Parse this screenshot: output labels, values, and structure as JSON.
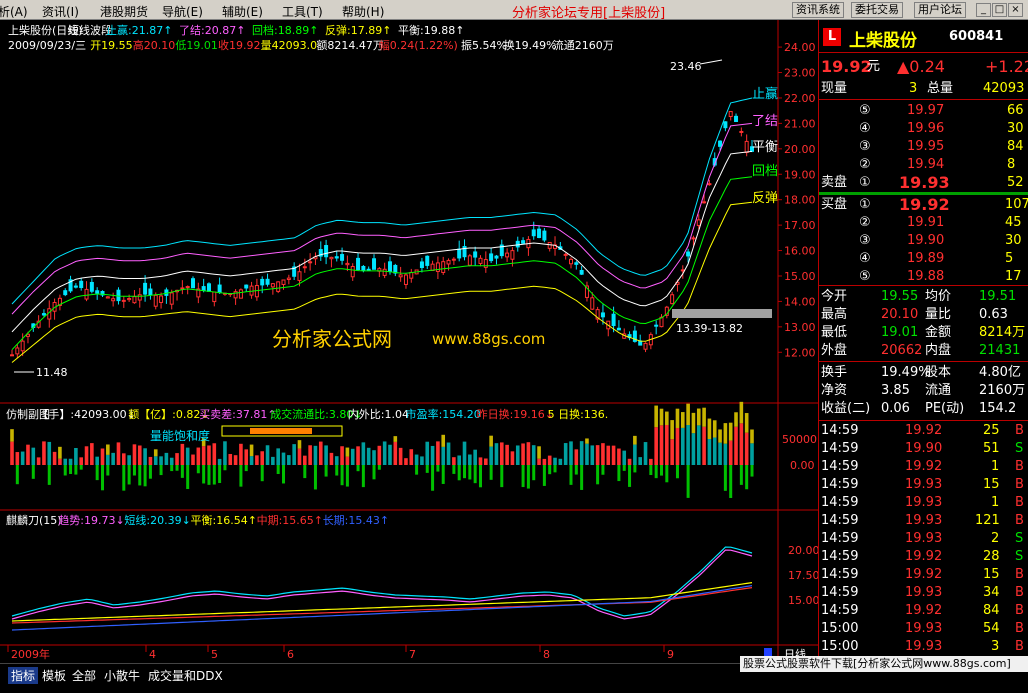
{
  "menubar": {
    "items": [
      "析(A)",
      "资讯(I)",
      "港股期货",
      "导航(E)",
      "辅助(E)",
      "工具(T)",
      "帮助(H)"
    ],
    "title": "分析家论坛专用[上柴股份]",
    "buttons": [
      "资讯系统",
      "委托交易",
      "用户论坛"
    ],
    "window_controls": [
      "_",
      "□",
      "×"
    ]
  },
  "main_chart": {
    "legend_line1": [
      {
        "text": "上柴股份(日线)",
        "color": "#ffffff"
      },
      {
        "text": "短线波段",
        "color": "#ffffff"
      },
      {
        "text": "止赢:21.87↑",
        "color": "#00e5ff"
      },
      {
        "text": "了结:20.87↑",
        "color": "#ff60ff"
      },
      {
        "text": "回档:18.89↑",
        "color": "#00ff00"
      },
      {
        "text": "反弹:17.89↑",
        "color": "#ffff00"
      },
      {
        "text": "平衡:19.88↑",
        "color": "#ffffff"
      }
    ],
    "legend_line2": [
      {
        "text": "2009/09/23/三",
        "color": "#ffffff"
      },
      {
        "text": "开19.55",
        "color": "#ffff00"
      },
      {
        "text": "高20.10",
        "color": "#ff3030"
      },
      {
        "text": "低19.01",
        "color": "#00e000"
      },
      {
        "text": "收19.92",
        "color": "#ff3030"
      },
      {
        "text": "量42093.0",
        "color": "#ffff00"
      },
      {
        "text": "额8214.47万",
        "color": "#ffffff"
      },
      {
        "text": "幅0.24(1.22%)",
        "color": "#ff3030"
      },
      {
        "text": "振5.54%",
        "color": "#ffffff"
      },
      {
        "text": "换19.49%",
        "color": "#ffffff"
      },
      {
        "text": "流通2160万",
        "color": "#ffffff"
      }
    ],
    "y_ticks": [
      "24.00",
      "23.00",
      "22.00",
      "21.00",
      "20.00",
      "19.00",
      "18.00",
      "17.00",
      "16.00",
      "15.00",
      "14.00",
      "13.00",
      "12.00"
    ],
    "band_labels": [
      {
        "text": "止赢",
        "color": "#00e5ff"
      },
      {
        "text": "了结",
        "color": "#ff60ff"
      },
      {
        "text": "平衡",
        "color": "#ffffff"
      },
      {
        "text": "回档",
        "color": "#00ff00"
      },
      {
        "text": "反弹",
        "color": "#ffff00"
      }
    ],
    "annotations": {
      "high_label": "23.46",
      "low_label": "11.48",
      "gap_label": "13.39-13.82",
      "watermark": "分析家公式网",
      "watermark_url": "www.88gs.com"
    }
  },
  "volume_panel": {
    "legend": [
      {
        "text": "仿制副图",
        "color": "#ffffff"
      },
      {
        "text": "【手】:42093.00↓",
        "color": "#ffffff"
      },
      {
        "text": "额【亿】:0.82↓",
        "color": "#ffff00"
      },
      {
        "text": "买卖差:37.81↑",
        "color": "#ff60ff"
      },
      {
        "text": "成交流通比:3.80↓",
        "color": "#00ff00"
      },
      {
        "text": "内外比:1.04",
        "color": "#ffffff"
      },
      {
        "text": "市盈率:154.20",
        "color": "#00e5ff"
      },
      {
        "text": "昨日换:19.16↓",
        "color": "#ff3030"
      },
      {
        "text": "5 日换:136.",
        "color": "#ffff00"
      }
    ],
    "y_ticks": [
      "50000",
      "0.00"
    ],
    "label": "量能饱和度"
  },
  "indicator_panel": {
    "legend": [
      {
        "text": "麒麟刀(15)",
        "color": "#ffffff"
      },
      {
        "text": "趋势:19.73↓",
        "color": "#ff60ff"
      },
      {
        "text": "短线:20.39↓",
        "color": "#00e5ff"
      },
      {
        "text": "平衡:16.54↑",
        "color": "#ffff00"
      },
      {
        "text": "中期:15.65↑",
        "color": "#ff3030"
      },
      {
        "text": "长期:15.43↑",
        "color": "#3060ff"
      }
    ],
    "y_ticks": [
      "20.00",
      "17.50",
      "15.00"
    ]
  },
  "x_axis": {
    "labels": [
      "2009年",
      "4",
      "5",
      "6",
      "7",
      "8",
      "9"
    ],
    "period": "日线"
  },
  "chart_data": {
    "type": "line",
    "title": "上柴股份(日线)",
    "ylim": [
      11.5,
      24.2
    ],
    "series": [
      {
        "name": "止赢",
        "values": [
          13.9,
          14.8,
          15.7,
          16.1,
          16.2,
          16.1,
          16.1,
          16.2,
          16.4,
          16.3,
          16.2,
          16.3,
          16.4,
          16.5,
          17.0,
          17.2,
          17.1,
          17.1,
          17.0,
          17.1,
          17.2,
          17.3,
          17.3,
          17.4,
          17.5,
          17.4,
          16.8,
          15.9,
          15.3,
          15.0,
          15.3,
          16.5,
          19.5,
          21.8,
          22.0
        ]
      },
      {
        "name": "了结",
        "values": [
          13.5,
          14.4,
          15.2,
          15.6,
          15.7,
          15.6,
          15.6,
          15.7,
          15.9,
          15.8,
          15.7,
          15.8,
          15.9,
          16.0,
          16.5,
          16.7,
          16.6,
          16.6,
          16.5,
          16.6,
          16.7,
          16.8,
          16.8,
          16.9,
          17.0,
          16.9,
          16.3,
          15.4,
          14.8,
          14.5,
          14.8,
          16.0,
          18.8,
          20.9,
          21.0
        ]
      },
      {
        "name": "平衡",
        "values": [
          12.8,
          13.7,
          14.5,
          14.9,
          15.0,
          14.9,
          14.9,
          15.0,
          15.2,
          15.1,
          15.0,
          15.1,
          15.2,
          15.3,
          15.8,
          16.0,
          15.9,
          15.9,
          15.8,
          15.9,
          16.0,
          16.1,
          16.1,
          16.2,
          16.3,
          16.2,
          15.6,
          14.7,
          14.1,
          13.8,
          14.1,
          15.3,
          18.0,
          19.8,
          19.9
        ]
      },
      {
        "name": "回档",
        "values": [
          12.1,
          13.0,
          13.8,
          14.2,
          14.3,
          14.2,
          14.2,
          14.3,
          14.5,
          14.4,
          14.3,
          14.4,
          14.5,
          14.6,
          15.1,
          15.3,
          15.2,
          15.2,
          15.1,
          15.2,
          15.3,
          15.4,
          15.4,
          15.5,
          15.6,
          15.5,
          14.9,
          14.0,
          13.4,
          13.1,
          13.4,
          14.6,
          17.1,
          18.8,
          18.9
        ]
      },
      {
        "name": "反弹",
        "values": [
          11.6,
          12.3,
          13.0,
          13.4,
          13.5,
          13.4,
          13.4,
          13.5,
          13.6,
          13.5,
          13.4,
          13.5,
          13.6,
          13.7,
          14.1,
          14.3,
          14.2,
          14.2,
          14.1,
          14.2,
          14.3,
          14.4,
          14.4,
          14.5,
          14.6,
          14.5,
          14.0,
          13.3,
          12.7,
          12.4,
          12.7,
          13.8,
          16.0,
          17.8,
          17.9
        ]
      },
      {
        "name": "收盘",
        "values": [
          11.9,
          13.0,
          14.0,
          14.6,
          14.3,
          14.0,
          14.3,
          14.2,
          14.6,
          14.4,
          14.3,
          14.6,
          14.7,
          15.0,
          15.8,
          15.7,
          15.2,
          15.3,
          15.0,
          15.4,
          15.6,
          15.8,
          15.6,
          16.0,
          16.6,
          16.2,
          15.4,
          13.5,
          12.8,
          12.2,
          13.6,
          15.6,
          18.5,
          21.5,
          19.9
        ]
      }
    ]
  },
  "quote_panel": {
    "stock_name": "上柴股份",
    "stock_code": "600841",
    "logo": "L",
    "price": "19.92",
    "price_unit": "元",
    "change": "▲0.24",
    "change_pct": "+1.22",
    "now_label": "现量",
    "now_val": "3",
    "total_label": "总量",
    "total_val": "42093",
    "sells": [
      {
        "idx": "⑤",
        "price": "19.97",
        "vol": "66"
      },
      {
        "idx": "④",
        "price": "19.96",
        "vol": "30"
      },
      {
        "idx": "③",
        "price": "19.95",
        "vol": "84"
      },
      {
        "idx": "②",
        "price": "19.94",
        "vol": "8"
      },
      {
        "idx": "①",
        "price": "19.93",
        "vol": "52",
        "label": "卖盘"
      }
    ],
    "buys": [
      {
        "idx": "①",
        "price": "19.92",
        "vol": "107",
        "label": "买盘"
      },
      {
        "idx": "②",
        "price": "19.91",
        "vol": "45"
      },
      {
        "idx": "③",
        "price": "19.90",
        "vol": "30"
      },
      {
        "idx": "④",
        "price": "19.89",
        "vol": "5"
      },
      {
        "idx": "⑤",
        "price": "19.88",
        "vol": "17"
      }
    ],
    "stats": [
      {
        "l1": "今开",
        "v1": "19.55",
        "c1": "green",
        "l2": "均价",
        "v2": "19.51",
        "c2": "green"
      },
      {
        "l1": "最高",
        "v1": "20.10",
        "c1": "red",
        "l2": "量比",
        "v2": "0.63",
        "c2": "white"
      },
      {
        "l1": "最低",
        "v1": "19.01",
        "c1": "green",
        "l2": "金额",
        "v2": "8214万",
        "c2": "yellow"
      },
      {
        "l1": "外盘",
        "v1": "20662",
        "c1": "red",
        "l2": "内盘",
        "v2": "21431",
        "c2": "green"
      },
      {
        "l1": "换手",
        "v1": "19.49%",
        "c1": "white",
        "l2": "股本",
        "v2": "4.80亿",
        "c2": "white"
      },
      {
        "l1": "净资",
        "v1": "3.85",
        "c1": "white",
        "l2": "流通",
        "v2": "2160万",
        "c2": "white"
      },
      {
        "l1": "收益(二)",
        "v1": "0.06",
        "c1": "white",
        "l2": "PE(动)",
        "v2": "154.2",
        "c2": "white"
      }
    ],
    "ticks": [
      {
        "time": "14:59",
        "price": "19.92",
        "vol": "25",
        "side": "B"
      },
      {
        "time": "14:59",
        "price": "19.90",
        "vol": "51",
        "side": "S"
      },
      {
        "time": "14:59",
        "price": "19.92",
        "vol": "1",
        "side": "B"
      },
      {
        "time": "14:59",
        "price": "19.93",
        "vol": "15",
        "side": "B"
      },
      {
        "time": "14:59",
        "price": "19.93",
        "vol": "1",
        "side": "B"
      },
      {
        "time": "14:59",
        "price": "19.93",
        "vol": "121",
        "side": "B"
      },
      {
        "time": "14:59",
        "price": "19.93",
        "vol": "2",
        "side": "S"
      },
      {
        "time": "14:59",
        "price": "19.92",
        "vol": "28",
        "side": "S"
      },
      {
        "time": "14:59",
        "price": "19.92",
        "vol": "15",
        "side": "B"
      },
      {
        "time": "14:59",
        "price": "19.93",
        "vol": "34",
        "side": "B"
      },
      {
        "time": "14:59",
        "price": "19.92",
        "vol": "84",
        "side": "B"
      },
      {
        "time": "15:00",
        "price": "19.93",
        "vol": "54",
        "side": "B"
      },
      {
        "time": "15:00",
        "price": "19.93",
        "vol": "3",
        "side": "B"
      }
    ]
  },
  "tabbar": {
    "tabs": [
      "指标",
      "模板",
      "全部",
      "小散牛",
      "成交量和DDX"
    ]
  },
  "ad_banner": "股票公式股票软件下载[分析家公式网www.88gs.com]"
}
